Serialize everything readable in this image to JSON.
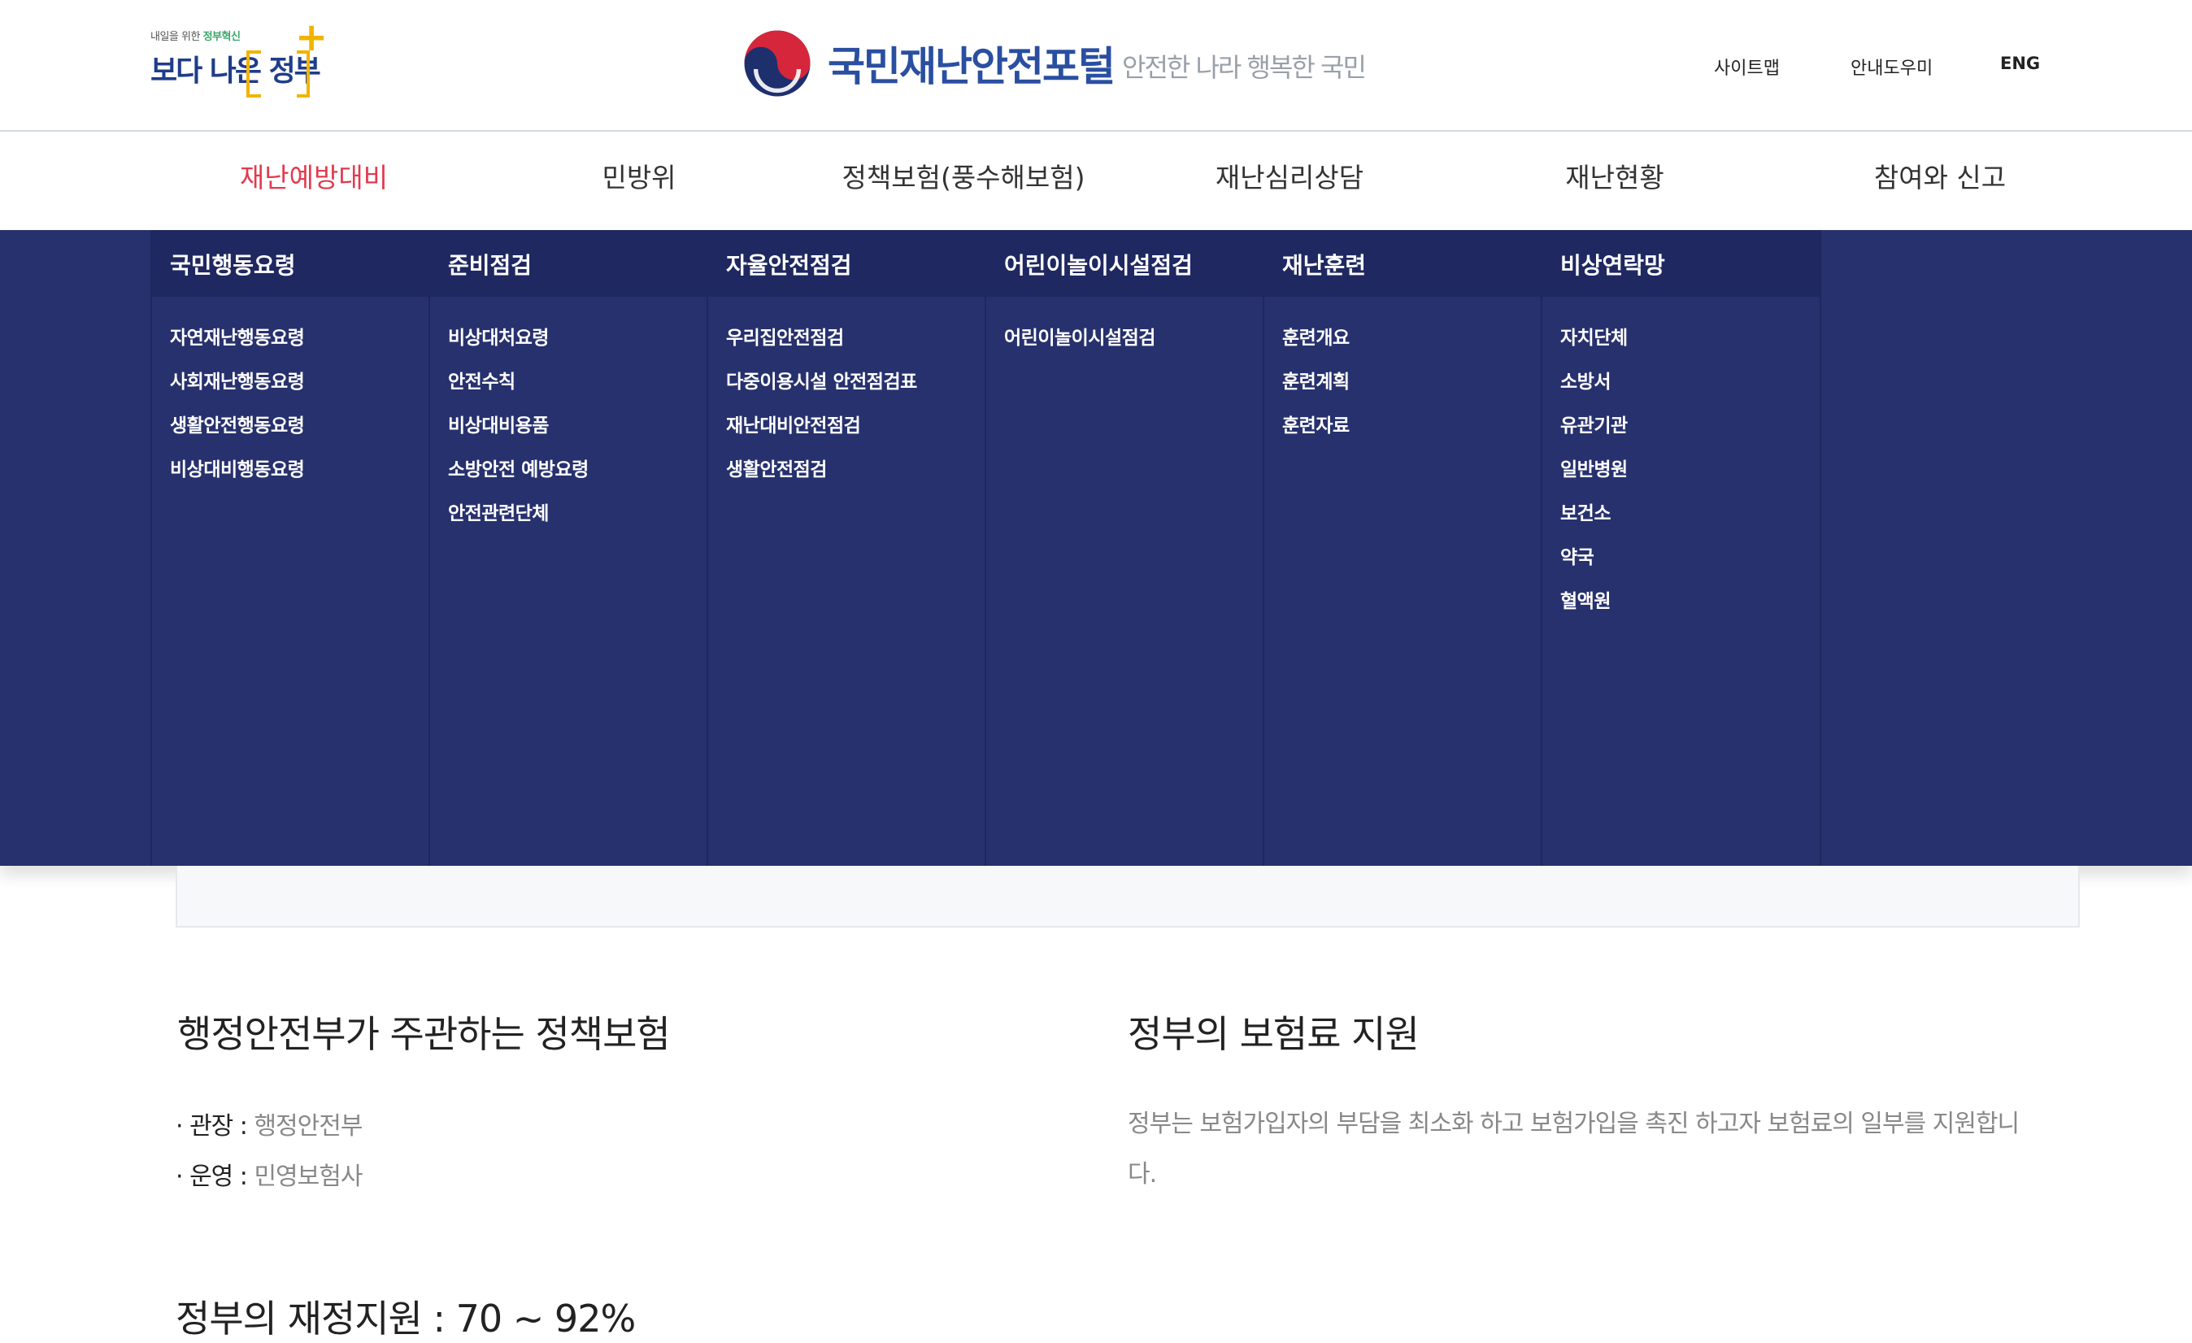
{
  "header": {
    "gov_logo_small_prefix": "내일을 위한 ",
    "gov_logo_small_highlight": "정부혁신",
    "gov_logo_text_a": "보다 나은",
    "gov_logo_text_b": "정부",
    "portal_title": "국민재난안전포털",
    "portal_slogan": "안전한 나라 행복한 국민",
    "util": {
      "sitemap": "사이트맵",
      "guide": "안내도우미",
      "eng": "ENG"
    }
  },
  "gnb": [
    {
      "label": "재난예방대비",
      "active": true
    },
    {
      "label": "민방위",
      "active": false
    },
    {
      "label": "정책보험(풍수해보험)",
      "active": false
    },
    {
      "label": "재난심리상담",
      "active": false
    },
    {
      "label": "재난현황",
      "active": false
    },
    {
      "label": "참여와 신고",
      "active": false
    }
  ],
  "mega_menu": [
    {
      "title": "국민행동요령",
      "links": [
        "자연재난행동요령",
        "사회재난행동요령",
        "생활안전행동요령",
        "비상대비행동요령"
      ]
    },
    {
      "title": "준비점검",
      "links": [
        "비상대처요령",
        "안전수칙",
        "비상대비용품",
        "소방안전 예방요령",
        "안전관련단체"
      ]
    },
    {
      "title": "자율안전점검",
      "links": [
        "우리집안전점검",
        "다중이용시설 안전점검표",
        "재난대비안전점검",
        "생활안전점검"
      ]
    },
    {
      "title": "어린이놀이시설점검",
      "links": [
        "어린이놀이시설점검"
      ]
    },
    {
      "title": "재난훈련",
      "links": [
        "훈련개요",
        "훈련계획",
        "훈련자료"
      ]
    },
    {
      "title": "비상연락망",
      "links": [
        "자치단체",
        "소방서",
        "유관기관",
        "일반병원",
        "보건소",
        "약국",
        "혈액원"
      ]
    }
  ],
  "content": {
    "left_title": "행정안전부가 주관하는 정책보험",
    "info": [
      {
        "key": "· 관장 : ",
        "value": "행정안전부"
      },
      {
        "key": "· 운영 : ",
        "value": "민영보험사"
      }
    ],
    "right_title": "정부의 보험료 지원",
    "right_desc": "정부는 보험가입자의 부담을 최소화 하고 보험가입을 촉진 하고자 보험료의 일부를 지원합니다.",
    "fin_title": "정부의 재정지원 : 70 ~ 92%"
  },
  "colors": {
    "accent_red": "#e13b4f",
    "mega_bg": "#27316e",
    "mega_head_bg": "#1f2861",
    "brand_blue": "#2a4fa0"
  }
}
